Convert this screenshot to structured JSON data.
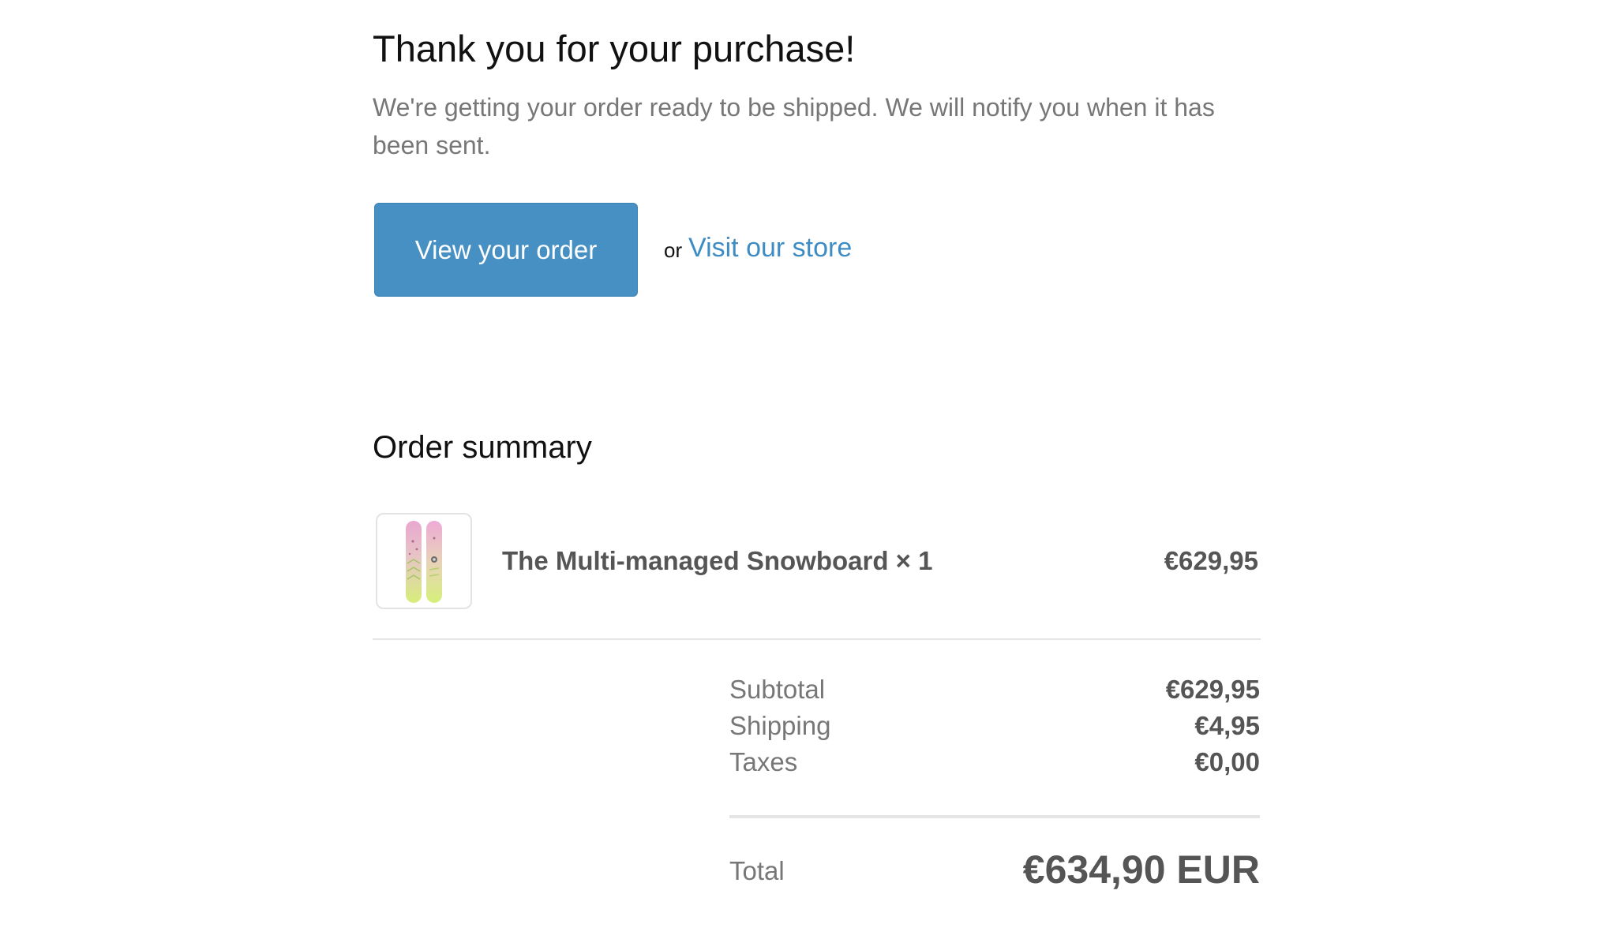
{
  "header": {
    "title": "Thank you for your purchase!",
    "subtitle": "We're getting your order ready to be shipped. We will notify you when it has been sent."
  },
  "actions": {
    "view_order_label": "View your order",
    "or_text": "or",
    "visit_store_label": "Visit our store"
  },
  "summary": {
    "heading": "Order summary",
    "items": [
      {
        "title": "The Multi-managed Snowboard × 1",
        "price": "€629,95",
        "image_icon": "snowboard-product-image"
      }
    ],
    "totals": [
      {
        "label": "Subtotal",
        "value": "€629,95"
      },
      {
        "label": "Shipping",
        "value": "€4,95"
      },
      {
        "label": "Taxes",
        "value": "€0,00"
      }
    ],
    "grand_total": {
      "label": "Total",
      "value": "€634,90 EUR"
    }
  },
  "colors": {
    "button": "#4690c4",
    "link": "#3d8cc4",
    "muted_text": "#777777"
  }
}
